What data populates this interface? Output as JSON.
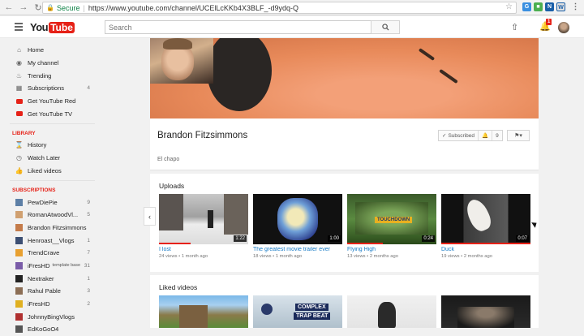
{
  "browser": {
    "secure_label": "Secure",
    "url": "https://www.youtube.com/channel/UCElLcKKb4X3BLF_-d9ydq-Q"
  },
  "header": {
    "logo_you": "You",
    "logo_tube": "Tube",
    "search_placeholder": "Search",
    "notification_count": "1"
  },
  "sidebar": {
    "items": [
      {
        "label": "Home",
        "icon": "home-icon",
        "count": ""
      },
      {
        "label": "My channel",
        "icon": "person-icon",
        "count": ""
      },
      {
        "label": "Trending",
        "icon": "flame-icon",
        "count": ""
      },
      {
        "label": "Subscriptions",
        "icon": "subscriptions-icon",
        "count": "4"
      },
      {
        "label": "Get YouTube Red",
        "icon": "youtube-red-icon",
        "count": ""
      },
      {
        "label": "Get YouTube TV",
        "icon": "youtube-tv-icon",
        "count": ""
      }
    ],
    "library_heading": "LIBRARY",
    "library": [
      {
        "label": "History",
        "icon": "history-icon"
      },
      {
        "label": "Watch Later",
        "icon": "clock-icon"
      },
      {
        "label": "Liked videos",
        "icon": "thumbs-up-icon"
      }
    ],
    "subscriptions_heading": "SUBSCRIPTIONS",
    "subscriptions": [
      {
        "label": "PewDiePie",
        "count": "9",
        "extra": "",
        "color": "#5d7fa6"
      },
      {
        "label": "RomanAtwoodVl...",
        "count": "5",
        "extra": "",
        "color": "#d0a070"
      },
      {
        "label": "Brandon Fitzsimmons",
        "count": "",
        "extra": "",
        "color": "#c47b4a"
      },
      {
        "label": "Henroast__Vlogs",
        "count": "1",
        "extra": "",
        "color": "#3c4f73"
      },
      {
        "label": "TrendCrave",
        "count": "7",
        "extra": "",
        "color": "#e8a030"
      },
      {
        "label": "iFresHD",
        "count": "31",
        "extra": "template base",
        "color": "#7a5ca8"
      },
      {
        "label": "Nextraker",
        "count": "1",
        "extra": "",
        "color": "#222222"
      },
      {
        "label": "Rahul Pable",
        "count": "3",
        "extra": "",
        "color": "#8c6e55"
      },
      {
        "label": "iFresHD",
        "count": "2",
        "extra": "",
        "color": "#e0b020"
      },
      {
        "label": "JohnnyBingVlogs",
        "count": "",
        "extra": "",
        "color": "#b03030"
      },
      {
        "label": "EdKoGoO4",
        "count": "",
        "extra": "",
        "color": "#555555"
      }
    ]
  },
  "channel": {
    "name": "Brandon Fitzsimmons",
    "description": "El chapo",
    "subscribed_label": "Subscribed",
    "subscriber_count": "9"
  },
  "uploads": {
    "title": "Uploads",
    "videos": [
      {
        "title": "I lost",
        "views": "24 views",
        "age": "1 month ago",
        "duration": "1:22",
        "progress": 0.35
      },
      {
        "title": "The greatest movie trailer ever",
        "views": "18 views",
        "age": "1 month ago",
        "duration": "1:00",
        "progress": 0.0
      },
      {
        "title": "Flying High",
        "views": "13 views",
        "age": "2 months ago",
        "duration": "0:24",
        "progress": 0.4
      },
      {
        "title": "Duck",
        "views": "19 views",
        "age": "2 months ago",
        "duration": "0:07",
        "progress": 1.0
      }
    ],
    "thumb_texts": {
      "touchdown": "TOUCHDOWN"
    }
  },
  "liked": {
    "title": "Liked videos",
    "thumb_texts": {
      "complex": "COMPLEX",
      "trap_beat": "TRAP BEAT"
    }
  },
  "colors": {
    "youtube_red": "#e62117",
    "link_blue": "#167ac6",
    "secure_green": "#0b8043"
  }
}
